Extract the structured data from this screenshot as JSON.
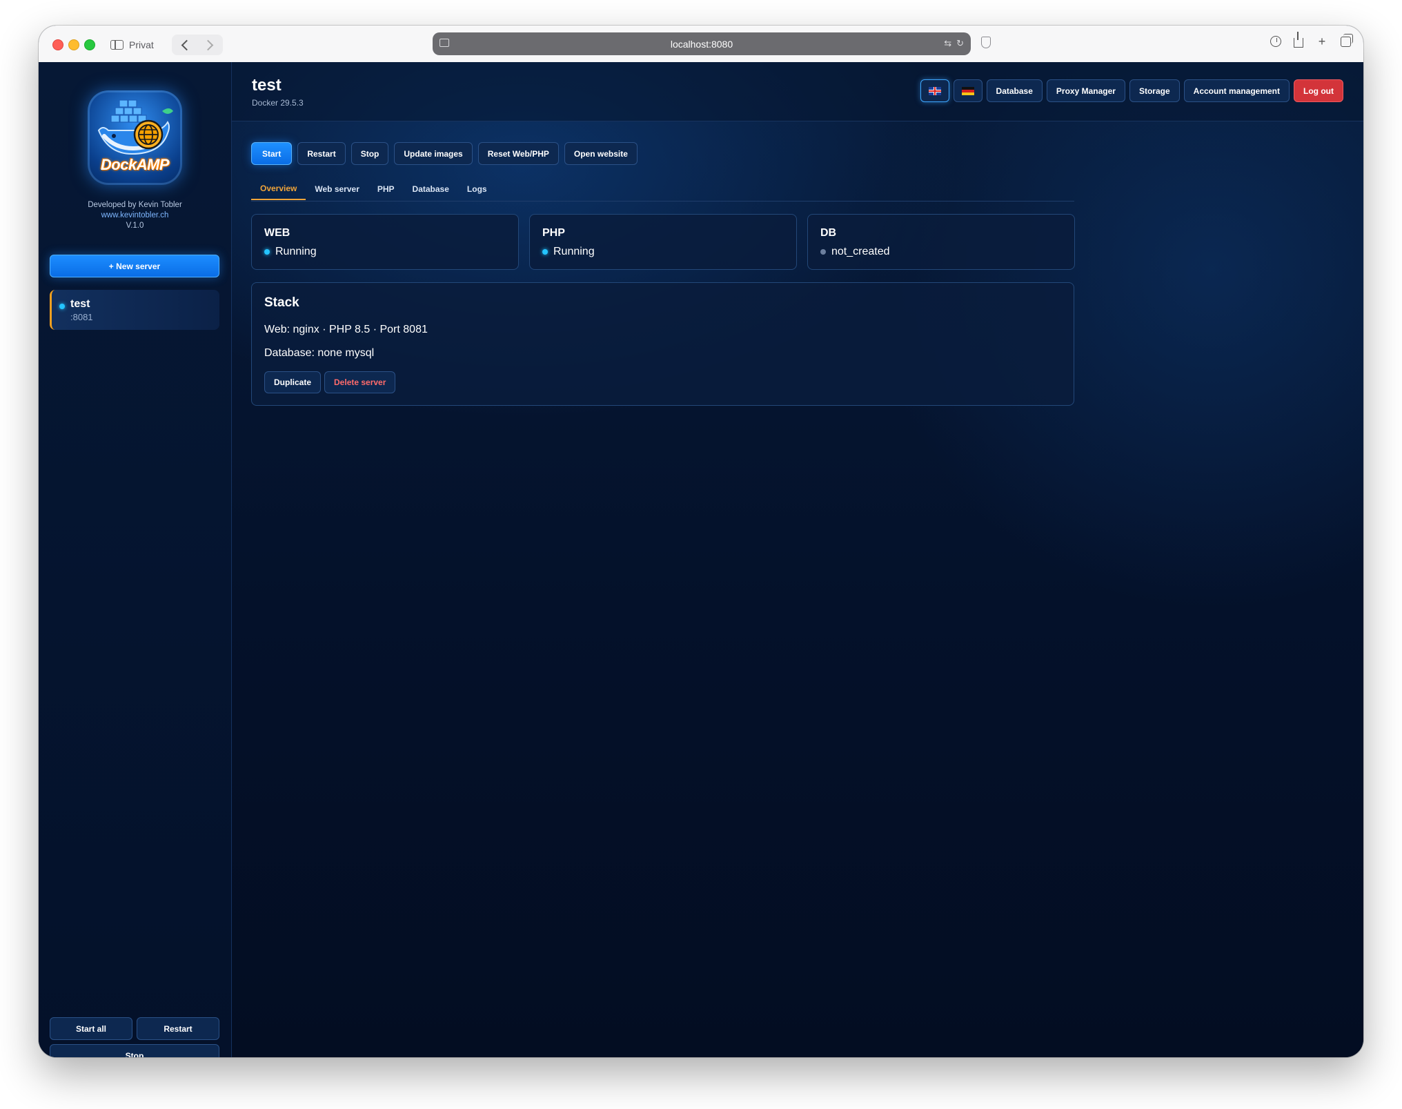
{
  "browser": {
    "private_label": "Privat",
    "url": "localhost:8080"
  },
  "sidebar": {
    "logo_text": "DockAMP",
    "developer": "Developed by Kevin Tobler",
    "website": "www.kevintobler.ch",
    "version": "V.1.0",
    "new_server_label": "+ New server",
    "servers": [
      {
        "name": "test",
        "port": ":8081",
        "status": "running"
      }
    ],
    "start_all_label": "Start all",
    "restart_label": "Restart",
    "stop_label": "Stop"
  },
  "header": {
    "title": "test",
    "docker_version": "Docker 29.5.3",
    "languages": [
      {
        "code": "en",
        "icon": "uk-flag-icon",
        "active": true
      },
      {
        "code": "de",
        "icon": "german-flag-icon",
        "active": false
      }
    ],
    "database_label": "Database",
    "proxy_manager_label": "Proxy Manager",
    "storage_label": "Storage",
    "account_label": "Account management",
    "logout_label": "Log out"
  },
  "actions": {
    "start": "Start",
    "restart": "Restart",
    "stop": "Stop",
    "update_images": "Update images",
    "reset": "Reset Web/PHP",
    "open_website": "Open website"
  },
  "tabs": [
    {
      "label": "Overview",
      "active": true
    },
    {
      "label": "Web server",
      "active": false
    },
    {
      "label": "PHP",
      "active": false
    },
    {
      "label": "Database",
      "active": false
    },
    {
      "label": "Logs",
      "active": false
    }
  ],
  "status_cards": [
    {
      "title": "WEB",
      "status": "Running",
      "state": "on"
    },
    {
      "title": "PHP",
      "status": "Running",
      "state": "on"
    },
    {
      "title": "DB",
      "status": "not_created",
      "state": "off"
    }
  ],
  "stack": {
    "title": "Stack",
    "web_line": "Web: nginx · PHP 8.5 · Port 8081",
    "db_line": "Database: none mysql",
    "duplicate_label": "Duplicate",
    "delete_label": "Delete server"
  },
  "colors": {
    "accent": "#1e90ff",
    "active_tab": "#f1a53a",
    "danger": "#d3343a",
    "running_dot": "#24c4ff"
  }
}
